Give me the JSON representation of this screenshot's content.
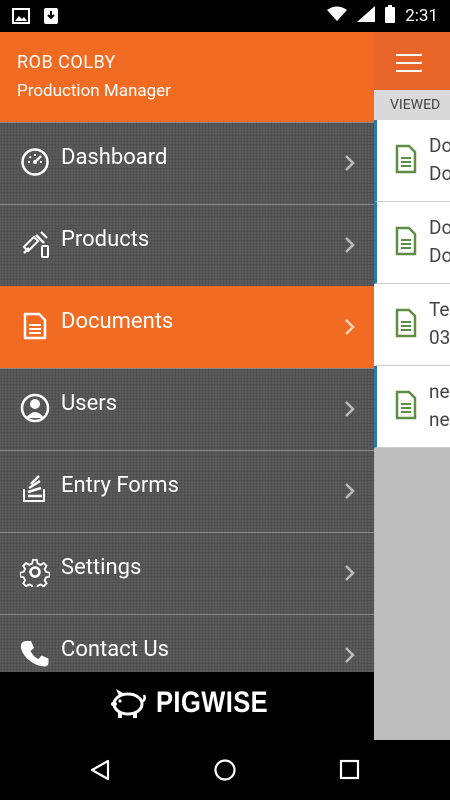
{
  "status_bar": {
    "time": "2:31",
    "icons": [
      "image-icon",
      "download-icon",
      "wifi-icon",
      "signal-icon",
      "battery-icon"
    ]
  },
  "background_app": {
    "tab_label": "VIEWED",
    "items": [
      {
        "line1": "Do",
        "line2": "Do"
      },
      {
        "line1": "Do",
        "line2": "Do"
      },
      {
        "line1": "Te",
        "line2": "03"
      },
      {
        "line1": "ne",
        "line2": "ne"
      }
    ]
  },
  "drawer": {
    "user_name": "ROB COLBY",
    "user_role": "Production Manager",
    "items": [
      {
        "label": "Dashboard",
        "icon": "speedometer-icon"
      },
      {
        "label": "Products",
        "icon": "syringe-icon"
      },
      {
        "label": "Documents",
        "icon": "document-icon",
        "active": true
      },
      {
        "label": "Users",
        "icon": "user-icon"
      },
      {
        "label": "Entry Forms",
        "icon": "forms-icon"
      },
      {
        "label": "Settings",
        "icon": "gear-icon"
      },
      {
        "label": "Contact Us",
        "icon": "phone-icon"
      }
    ],
    "footer_logo": "PIGWISE"
  },
  "colors": {
    "accent": "#f26b22",
    "drawer_bg": "#5a5a5a",
    "list_highlight": "#2a7ab0"
  }
}
